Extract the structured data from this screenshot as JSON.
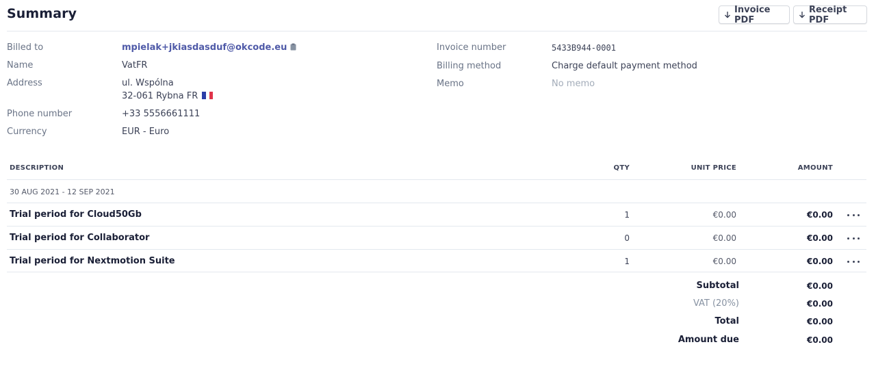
{
  "header": {
    "title": "Summary",
    "invoice_pdf_label": "Invoice PDF",
    "receipt_pdf_label": "Receipt PDF"
  },
  "details_left": {
    "billed_to_label": "Billed to",
    "billed_to_value": "mpielak+jkiasdasduf@okcode.eu",
    "name_label": "Name",
    "name_value": "VatFR",
    "address_label": "Address",
    "address_line1": "ul. Wspólna",
    "address_line2": "32-061 Rybna FR",
    "phone_label": "Phone number",
    "phone_value": "+33 5556661111",
    "currency_label": "Currency",
    "currency_value": "EUR - Euro"
  },
  "details_right": {
    "invoice_number_label": "Invoice number",
    "invoice_number_value": "5433B944-0001",
    "billing_method_label": "Billing method",
    "billing_method_value": "Charge default payment method",
    "memo_label": "Memo",
    "memo_value": "No memo"
  },
  "table": {
    "headers": {
      "description": "DESCRIPTION",
      "qty": "QTY",
      "unit_price": "UNIT PRICE",
      "amount": "AMOUNT"
    },
    "period": "30 AUG 2021 - 12 SEP 2021",
    "rows": [
      {
        "description": "Trial period for Cloud50Gb",
        "qty": "1",
        "unit_price": "€0.00",
        "amount": "€0.00"
      },
      {
        "description": "Trial period for Collaborator",
        "qty": "0",
        "unit_price": "€0.00",
        "amount": "€0.00"
      },
      {
        "description": "Trial period for Nextmotion Suite",
        "qty": "1",
        "unit_price": "€0.00",
        "amount": "€0.00"
      }
    ]
  },
  "totals": {
    "subtotal_label": "Subtotal",
    "subtotal_value": "€0.00",
    "vat_label": "VAT (20%)",
    "vat_value": "€0.00",
    "total_label": "Total",
    "total_value": "€0.00",
    "amount_due_label": "Amount due",
    "amount_due_value": "€0.00"
  },
  "colors": {
    "link": "#4f5aa8",
    "border": "#e3e8ee",
    "muted_text": "#697386"
  },
  "icons": {
    "download": "arrow-down-icon",
    "copy": "clipboard-icon",
    "flag": "france-flag-icon",
    "row_menu": "more-horizontal-icon"
  }
}
